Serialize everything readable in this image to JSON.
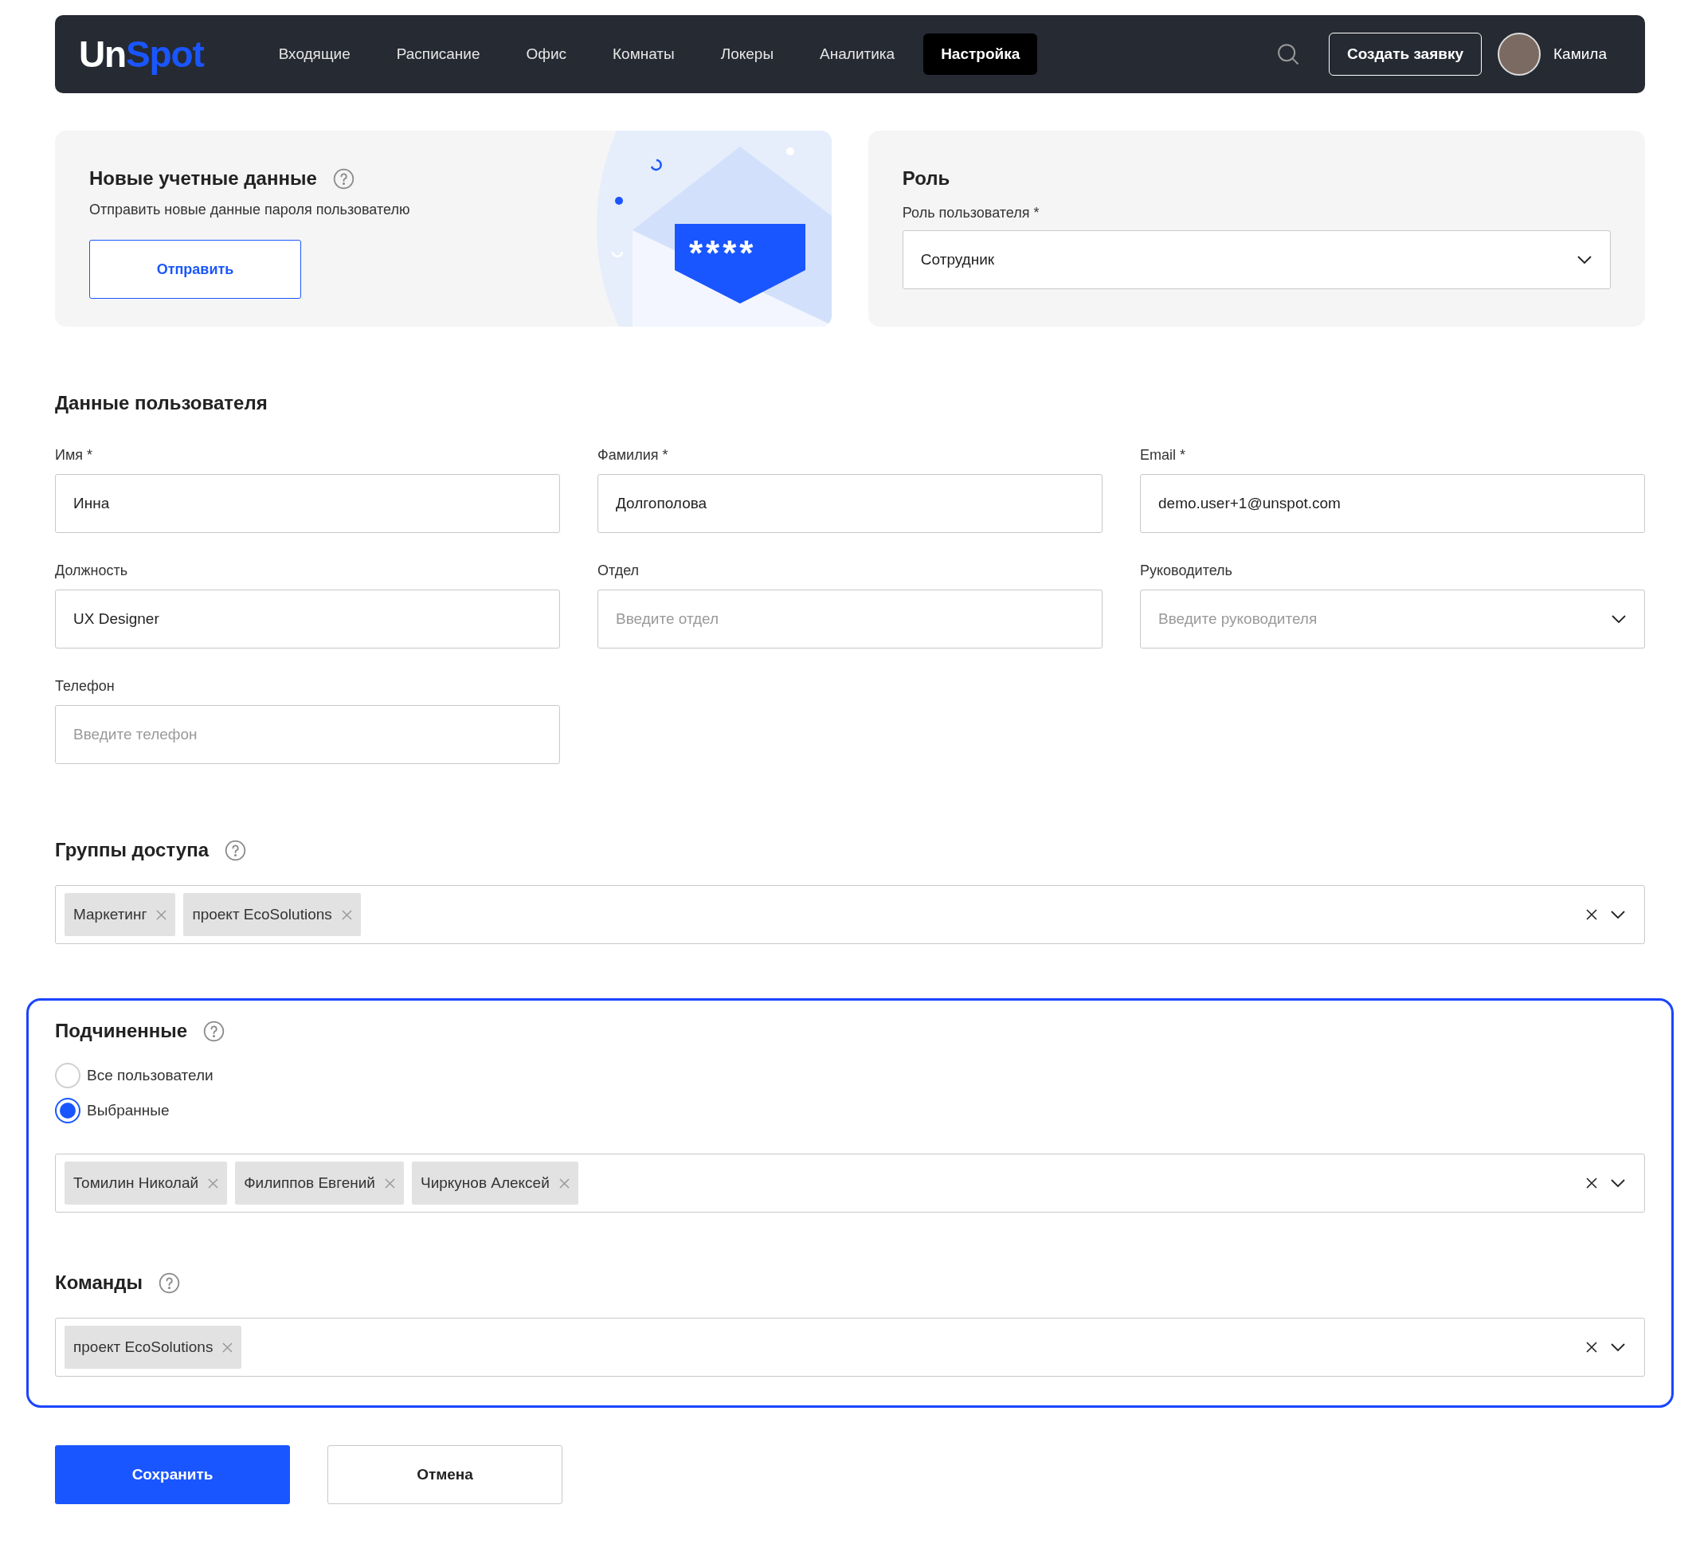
{
  "header": {
    "logo": [
      "Un",
      "Spot"
    ],
    "nav": [
      {
        "label": "Входящие",
        "selected": false
      },
      {
        "label": "Расписание",
        "selected": false
      },
      {
        "label": "Офис",
        "selected": false
      },
      {
        "label": "Комнаты",
        "selected": false
      },
      {
        "label": "Локеры",
        "selected": false
      },
      {
        "label": "Аналитика",
        "selected": false
      },
      {
        "label": "Настройка",
        "selected": true
      }
    ],
    "create_button": "Создать заявку",
    "user_name": "Камила"
  },
  "credentials": {
    "title": "Новые учетные данные",
    "description": "Отправить новые данные пароля пользователю",
    "button": "Отправить",
    "masked": "****"
  },
  "role": {
    "title": "Роль",
    "label": "Роль пользователя *",
    "value": "Сотрудник"
  },
  "user_data": {
    "title": "Данные пользователя",
    "fields": [
      {
        "kind": "text",
        "label": "Имя *",
        "value": "Инна"
      },
      {
        "kind": "text",
        "label": "Фамилия *",
        "value": "Долгополова"
      },
      {
        "kind": "text",
        "label": "Email *",
        "value": "demo.user+1@unspot.com"
      },
      {
        "kind": "text",
        "label": "Должность",
        "value": "UX Designer"
      },
      {
        "kind": "text",
        "label": "Отдел",
        "placeholder": "Введите отдел"
      },
      {
        "kind": "select",
        "label": "Руководитель",
        "placeholder": "Введите руководителя"
      },
      {
        "kind": "text",
        "label": "Телефон",
        "placeholder": "Введите телефон"
      }
    ]
  },
  "access_groups": {
    "title": "Группы доступа",
    "tags": [
      "Маркетинг",
      "проект EcoSolutions"
    ]
  },
  "subordinates": {
    "title": "Подчиненные",
    "options": [
      {
        "label": "Все пользователи",
        "selected": false
      },
      {
        "label": "Выбранные",
        "selected": true
      }
    ],
    "tags": [
      "Томилин Николай",
      "Филиппов Евгений",
      "Чиркунов Алексей"
    ]
  },
  "teams": {
    "title": "Команды",
    "tags": [
      "проект EcoSolutions"
    ]
  },
  "buttons": {
    "save": "Сохранить",
    "cancel": "Отмена"
  }
}
